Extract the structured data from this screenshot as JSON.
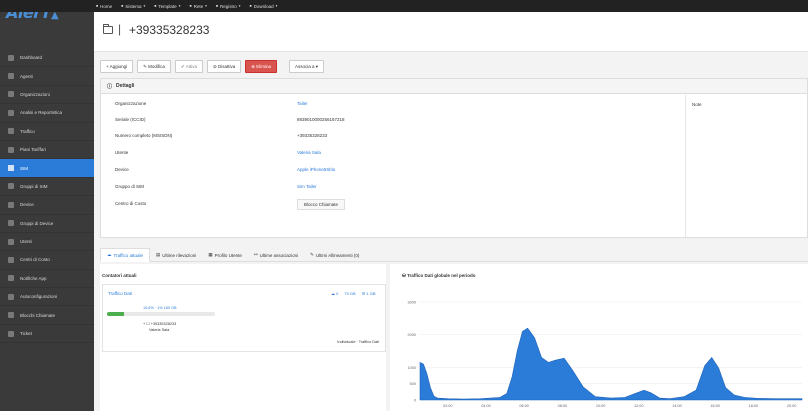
{
  "app": {
    "logo": "AlerT",
    "logo_mark": "▲"
  },
  "topnav": [
    {
      "label": "Home",
      "icon": "home-icon"
    },
    {
      "label": "Sistema",
      "icon": "gear-icon"
    },
    {
      "label": "Template",
      "icon": "file-icon"
    },
    {
      "label": "Rete",
      "icon": "network-icon"
    },
    {
      "label": "Registro",
      "icon": "list-icon"
    },
    {
      "label": "Download",
      "icon": "download-icon"
    }
  ],
  "sidebar": {
    "items": [
      {
        "label": "Dashboard",
        "active": false
      },
      {
        "label": "Agenti",
        "active": false
      },
      {
        "label": "Organizzazioni",
        "active": false
      },
      {
        "label": "Analisi e Reportistica",
        "active": false
      },
      {
        "label": "Traffico",
        "active": false
      },
      {
        "label": "Piani Tariffari",
        "active": false
      },
      {
        "label": "SIM",
        "active": true
      },
      {
        "label": "Gruppi di SIM",
        "active": false
      },
      {
        "label": "Device",
        "active": false
      },
      {
        "label": "Gruppi di Device",
        "active": false
      },
      {
        "label": "Utenti",
        "active": false
      },
      {
        "label": "Centri di Costo",
        "active": false
      },
      {
        "label": "Notifiche App",
        "active": false
      },
      {
        "label": "Autoconfigurazioni",
        "active": false
      },
      {
        "label": "Blocchi Chiamate",
        "active": false
      },
      {
        "label": "Ticket",
        "active": false
      }
    ]
  },
  "header": {
    "separator": "|",
    "title": "+39335328233"
  },
  "toolbar": {
    "add": "+ Aggiungi",
    "edit": "✎ Modifica",
    "activate": "✔ Attiva",
    "deactivate": "⊘ Disattiva",
    "delete": "⊗ Elimina",
    "associate": "Associa a ▾"
  },
  "details": {
    "heading": "Dettagli",
    "note_label": "Note",
    "rows": [
      {
        "label": "Organizzazione",
        "value": "Tailer",
        "link": true
      },
      {
        "label": "Seriale (ICCID)",
        "value": "8939010000256167218",
        "link": false
      },
      {
        "label": "Numero completo (MSISDN)",
        "value": "+39335328233",
        "link": false
      },
      {
        "label": "Utente",
        "value": "Valeria Sala",
        "link": true
      },
      {
        "label": "Device",
        "value": "Apple iPhone5Sblu",
        "link": true
      },
      {
        "label": "Gruppo di SIM",
        "value": "Sim Tailer",
        "link": true
      },
      {
        "label": "Centro di Costo",
        "value": "Blocco Chiamate",
        "link": false
      }
    ]
  },
  "tabs": [
    {
      "label": "Traffico attuale",
      "active": true
    },
    {
      "label": "Ultime rilevazioni",
      "active": false
    },
    {
      "label": "Profilo Utente",
      "active": false
    },
    {
      "label": "Ultime associazioni",
      "active": false
    },
    {
      "label": "Ultimi Allineamenti (0)",
      "active": false
    }
  ],
  "counters": {
    "heading": "Contatori attuali",
    "card": {
      "name": "Traffico Dati",
      "stat1": "☁ 0",
      "stat2": "70 GB",
      "stat3": "☰ 1 GB",
      "percent_text": "10,6% · 1% 180 GB",
      "fill_fraction": 0.16,
      "sim": "+ ☐ +39335328233",
      "user": "Valeria Sala",
      "footer": "Individuale · Traffico Dati"
    }
  },
  "chart_data": {
    "type": "area",
    "title": "Traffico Dati globale nel periodo",
    "xlabel": "",
    "ylabel": "",
    "x_ticks": [
      "02:00",
      "04:00",
      "06:00",
      "08:00",
      "10:00",
      "12:00",
      "14:00",
      "16:00",
      "18:00",
      "20:00"
    ],
    "y_ticks": [
      "3000",
      "2000",
      "1000",
      "500",
      "0"
    ],
    "ylim": [
      0,
      3000
    ],
    "color": "#2b7bd9",
    "series": [
      {
        "x": [
          0.0,
          0.2,
          0.4,
          0.6,
          0.8,
          1.0,
          1.6,
          2.5,
          3.5,
          4.6,
          5.0,
          5.3,
          5.6,
          5.9,
          6.2,
          6.6,
          7.0,
          7.4,
          7.8,
          8.3,
          8.8,
          9.4,
          10.1,
          11.0,
          11.8,
          12.4,
          12.9,
          13.3,
          13.8,
          14.4,
          15.2,
          15.9,
          16.4,
          16.8,
          17.2,
          17.6,
          18.1,
          18.7,
          19.5,
          20.5,
          21.5,
          22.0
        ],
        "values": [
          1150,
          1100,
          800,
          380,
          120,
          60,
          40,
          30,
          40,
          80,
          200,
          700,
          1500,
          2100,
          2200,
          1900,
          1300,
          1150,
          1220,
          1280,
          900,
          400,
          100,
          60,
          80,
          200,
          300,
          220,
          60,
          40,
          100,
          300,
          1050,
          1300,
          980,
          380,
          150,
          80,
          50,
          40,
          40,
          40
        ]
      }
    ]
  }
}
